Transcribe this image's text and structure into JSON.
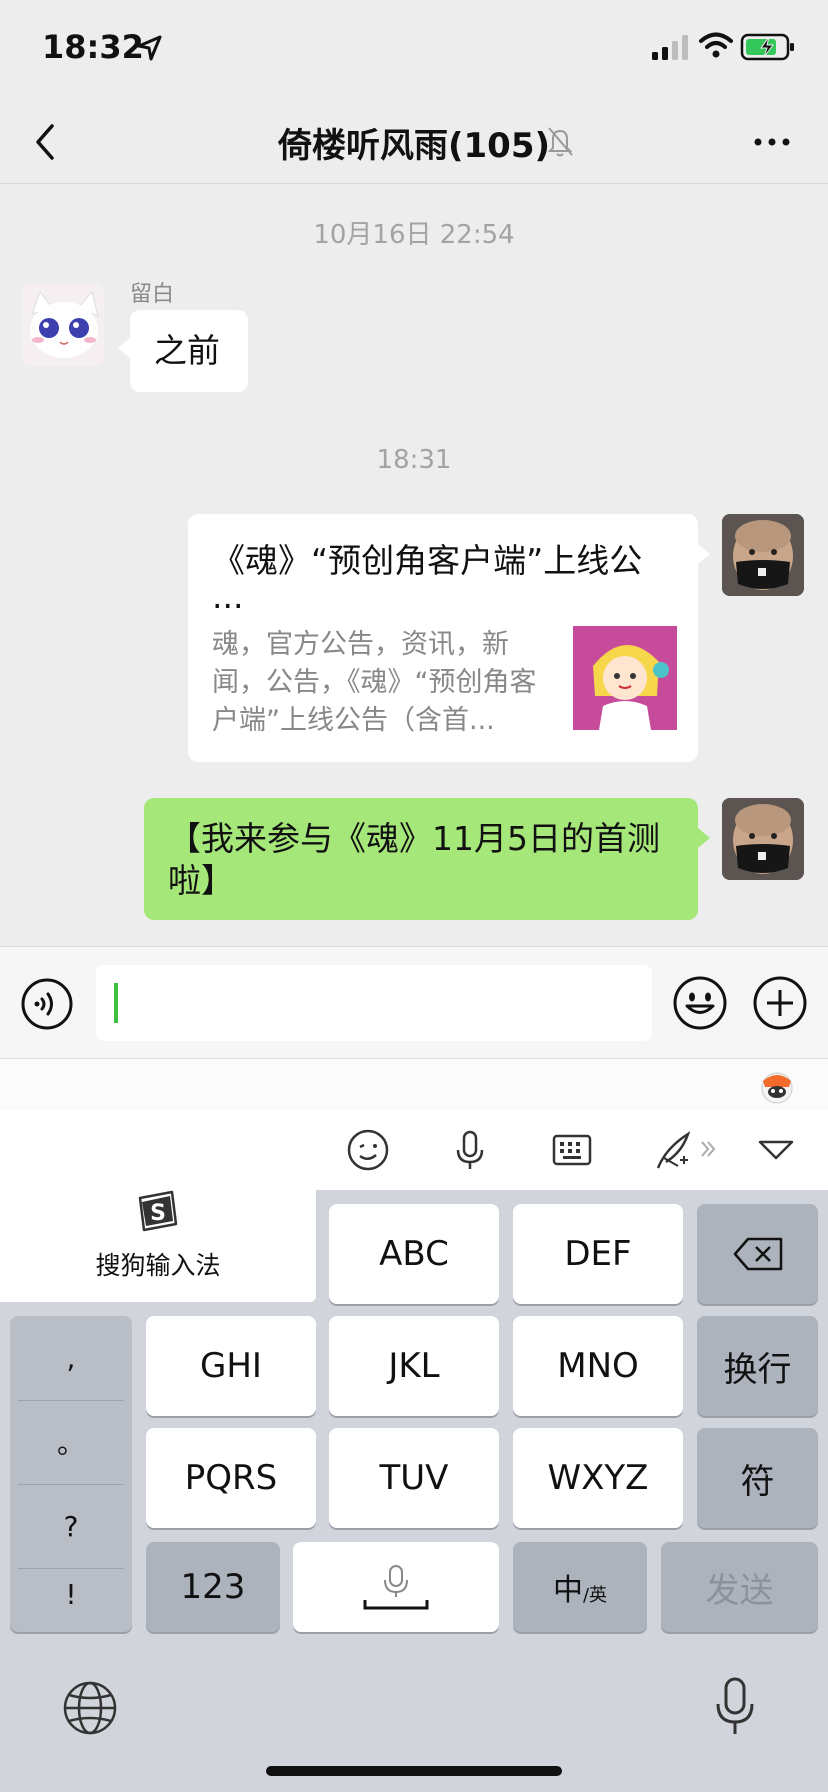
{
  "status_bar": {
    "time": "18:32",
    "battery_color": "#34c759"
  },
  "nav": {
    "title": "倚楼听风雨(105)"
  },
  "chat": {
    "timestamp_1": "10月16日 22:54",
    "msg1": {
      "sender": "留白",
      "text": "之前"
    },
    "timestamp_2": "18:31",
    "link_card": {
      "title": "《魂》“预创角客户端”上线公",
      "title_more": "...",
      "desc": "魂，官方公告，资讯，新闻，公告，《魂》“预创角客户端”上线公告（含首..."
    },
    "msg3": {
      "text": "【我来参与《魂》11月5日的首测啦】"
    }
  },
  "keyboard": {
    "brand": "搜狗输入法",
    "keys": {
      "abc": "ABC",
      "def": "DEF",
      "ghi": "GHI",
      "jkl": "JKL",
      "mno": "MNO",
      "newline": "换行",
      "pqrs": "PQRS",
      "tuv": "TUV",
      "wxyz": "WXYZ",
      "symbols": "符",
      "numbers": "123",
      "lang_main": "中",
      "lang_sub": "/英",
      "send": "发送"
    },
    "punct": [
      ",",
      "。",
      "?",
      "!"
    ]
  },
  "colors": {
    "bubble_green": "#a6e77a",
    "caret": "#3fbf3f"
  }
}
